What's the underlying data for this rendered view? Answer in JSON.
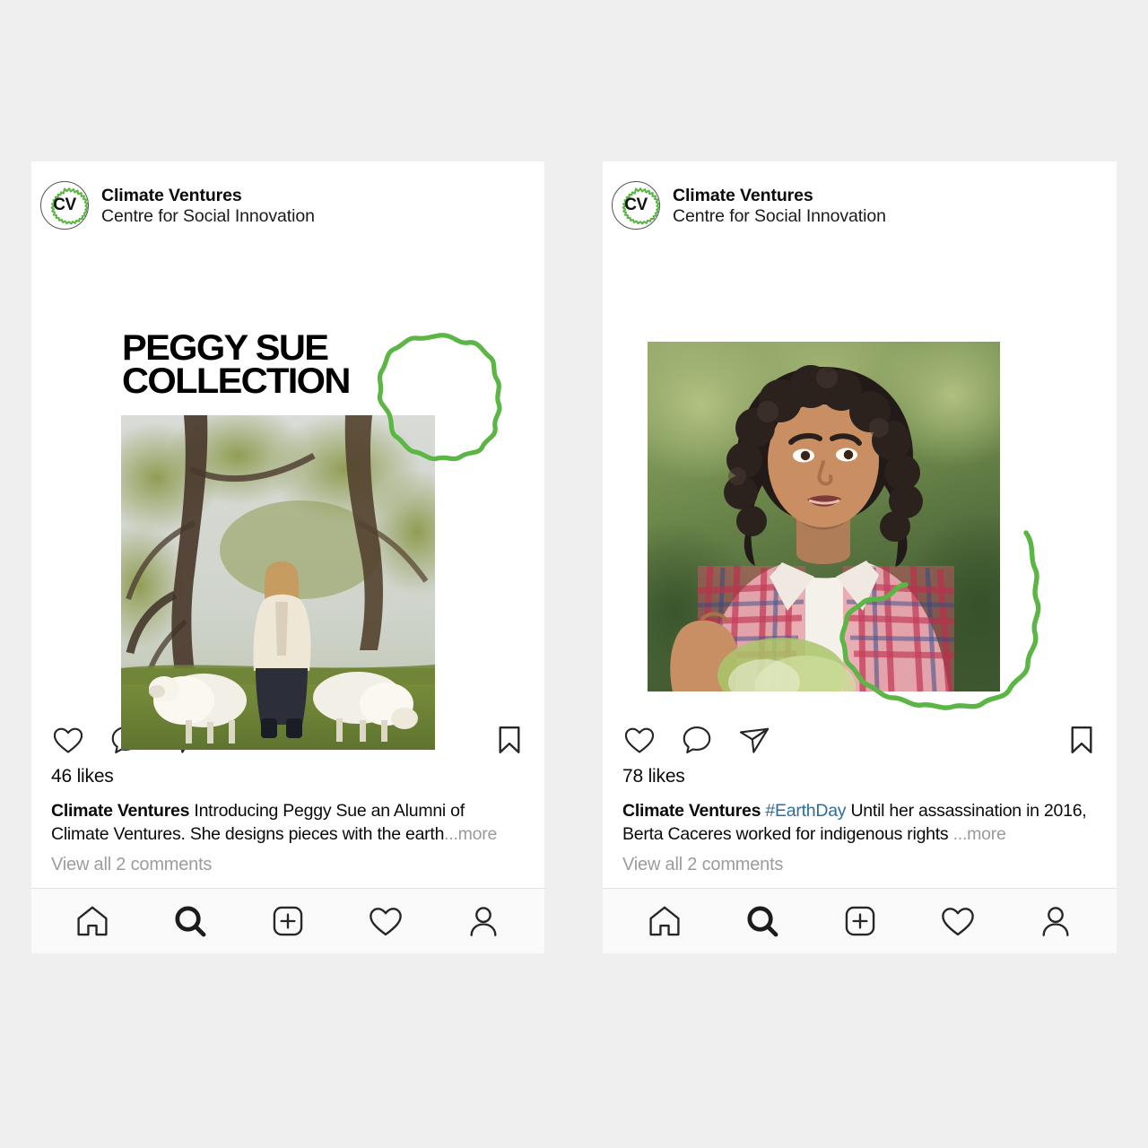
{
  "page": {
    "background_color": "#efefef",
    "brand_green": "#5cb646",
    "link_blue": "#2b6d9e",
    "muted_gray": "#9c9c9c"
  },
  "posts": [
    {
      "id": "peggy-sue-post",
      "header": {
        "avatar_initials": "CV",
        "account_name": "Climate Ventures",
        "account_subtitle": "Centre for Social Innovation"
      },
      "media": {
        "overlay_title": "PEGGY SUE\nCOLLECTION",
        "photo_alt": "Woman in cream jacket standing with two sheep in a grassy wooded field",
        "decoration": "green-wavy-circle-outline"
      },
      "actions": {
        "like": "like-icon",
        "comment": "comment-icon",
        "share": "share-icon",
        "save": "bookmark-icon"
      },
      "likes_text": "46 likes",
      "caption": {
        "username": "Climate Ventures",
        "hashtag": "",
        "body": "Introducing Peggy Sue an Alumni of Climate Ventures. She designs pieces with the earth",
        "more_label": "...more"
      },
      "comments_link": "View all 2 comments"
    },
    {
      "id": "berta-caceres-post",
      "header": {
        "avatar_initials": "CV",
        "account_name": "Climate Ventures",
        "account_subtitle": "Centre for Social Innovation"
      },
      "media": {
        "overlay_title": "",
        "photo_alt": "Portrait of a woman with dark curly hair in a pink plaid shirt speaking outdoors",
        "decoration": "green-wavy-blob-outline"
      },
      "actions": {
        "like": "like-icon",
        "comment": "comment-icon",
        "share": "share-icon",
        "save": "bookmark-icon"
      },
      "likes_text": "78 likes",
      "caption": {
        "username": "Climate Ventures",
        "hashtag": "#EarthDay",
        "body": "Until her assassination in 2016, Berta Caceres worked for indigenous rights",
        "more_label": "...more"
      },
      "comments_link": "View all 2 comments"
    }
  ],
  "navbar": {
    "items": [
      {
        "name": "home",
        "icon": "home-icon",
        "active": false
      },
      {
        "name": "search",
        "icon": "search-icon",
        "active": true
      },
      {
        "name": "create",
        "icon": "plus-square-icon",
        "active": false
      },
      {
        "name": "activity",
        "icon": "heart-icon",
        "active": false
      },
      {
        "name": "profile",
        "icon": "person-icon",
        "active": false
      }
    ]
  }
}
